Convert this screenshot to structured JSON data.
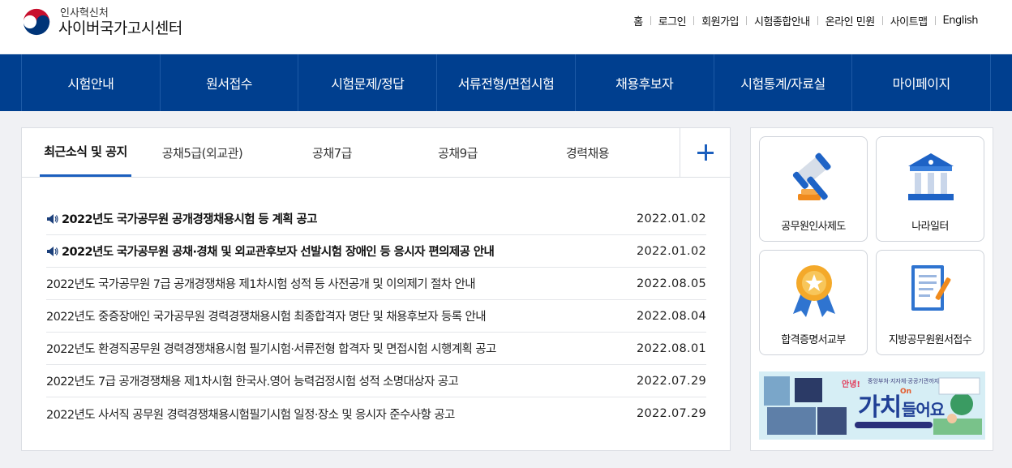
{
  "header": {
    "logo_sub": "인사혁신처",
    "logo_main": "사이버국가고시센터",
    "util_links": [
      "홈",
      "로그인",
      "회원가입",
      "시험종합안내",
      "온라인 민원",
      "사이트맵",
      "English"
    ]
  },
  "gnb": {
    "items": [
      "시험안내",
      "원서접수",
      "시험문제/정답",
      "서류전형/면접시험",
      "채용후보자",
      "시험통계/자료실",
      "마이페이지"
    ]
  },
  "notice": {
    "tabs": [
      "최근소식 및 공지",
      "공채5급(외교관)",
      "공채7급",
      "공채9급",
      "경력채용"
    ],
    "rows": [
      {
        "title": "2022년도 국가공무원 공개경쟁채용시험 등 계획 공고",
        "date": "2022.01.02"
      },
      {
        "title": "2022년도 국가공무원 공채·경채 및 외교관후보자 선발시험 장애인 등 응시자 편의제공 안내",
        "date": "2022.01.02"
      },
      {
        "title": "2022년도 국가공무원 7급 공개경쟁채용 제1차시험 성적 등 사전공개 및 이의제기 절차 안내",
        "date": "2022.08.05"
      },
      {
        "title": "2022년도 중증장애인 국가공무원 경력경쟁채용시험 최종합격자 명단 및 채용후보자 등록 안내",
        "date": "2022.08.04"
      },
      {
        "title": "2022년도 환경직공무원 경력경쟁채용시험 필기시험·서류전형 합격자 및 면접시험 시행계획 공고",
        "date": "2022.08.01"
      },
      {
        "title": "2022년도 7급 공개경쟁채용 제1차시험 한국사.영어 능력검정시험 성적 소명대상자 공고",
        "date": "2022.07.29"
      },
      {
        "title": "2022년도 사서직 공무원 경력경쟁채용시험필기시험 일정·장소 및 응시자 준수사항 공고",
        "date": "2022.07.29"
      }
    ]
  },
  "quick": {
    "items": [
      "공무원인사제도",
      "나라일터",
      "합격증명서교부",
      "지방공무원원서접수"
    ]
  },
  "banner": {
    "badge": "안녕!",
    "top": "중앙부처·지자체·공공기관까지",
    "main": "가치",
    "ons": "On",
    "sub": "들어요"
  },
  "colors": {
    "gnb_bg": "#003f8f",
    "accent": "#1b5fbe"
  }
}
